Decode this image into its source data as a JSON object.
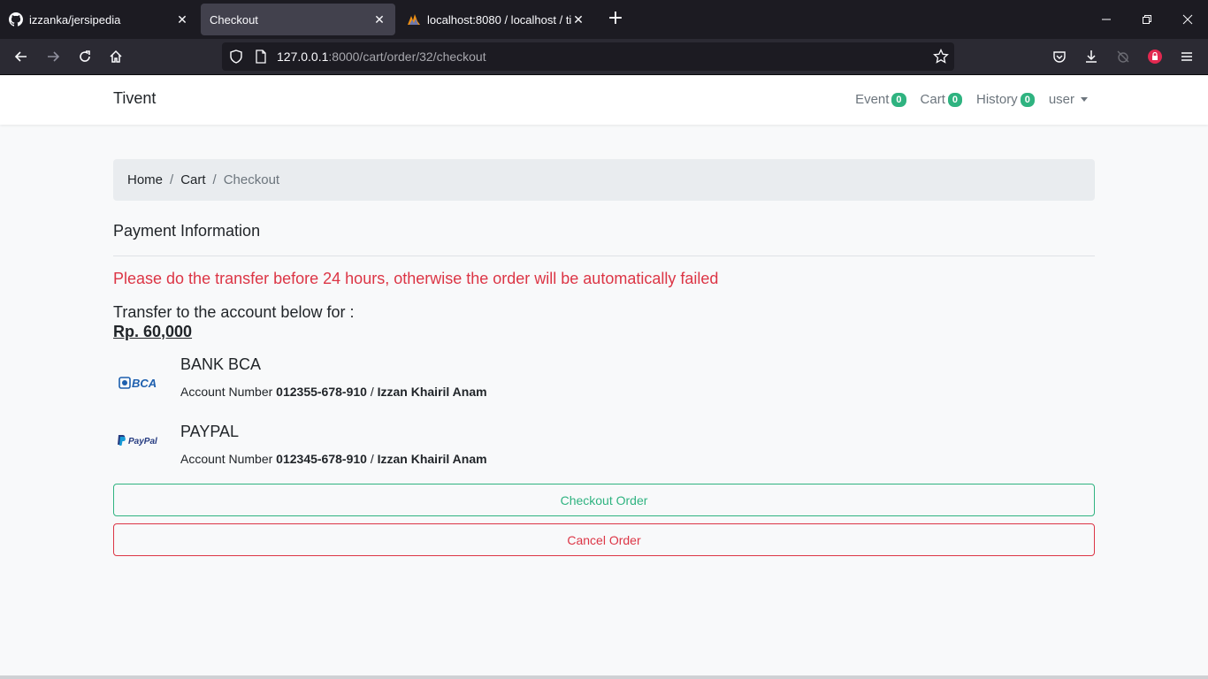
{
  "browser": {
    "tabs": [
      {
        "title": "izzanka/jersipedia",
        "icon": "github-icon"
      },
      {
        "title": "Checkout",
        "icon": ""
      },
      {
        "title": "localhost:8080 / localhost / tiver",
        "icon": "phpmyadmin-icon"
      }
    ],
    "url_host": "127.0.0.1",
    "url_path": ":8000/cart/order/32/checkout"
  },
  "app": {
    "brand": "Tivent",
    "nav": {
      "event_label": "Event",
      "event_count": "0",
      "cart_label": "Cart",
      "cart_count": "0",
      "history_label": "History",
      "history_count": "0",
      "user_label": "user"
    },
    "breadcrumb": {
      "home": "Home",
      "cart": "Cart",
      "current": "Checkout"
    },
    "payment": {
      "title": "Payment Information",
      "warning": "Please do the transfer before 24 hours, otherwise the order will be automatically failed",
      "transfer_label": "Transfer to the account below for :",
      "amount": "Rp. 60,000"
    },
    "banks": [
      {
        "name": "BANK BCA",
        "logo_text": "BCA",
        "account_label": "Account Number",
        "account_number": "012355-678-910",
        "separator": "/",
        "account_holder": "Izzan Khairil Anam"
      },
      {
        "name": "PAYPAL",
        "logo_text": "PayPal",
        "account_label": "Account Number",
        "account_number": "012345-678-910",
        "separator": "/",
        "account_holder": "Izzan Khairil Anam"
      }
    ],
    "buttons": {
      "checkout": "Checkout Order",
      "cancel": "Cancel Order"
    }
  },
  "colors": {
    "success": "#2fb380",
    "danger": "#dc3545",
    "bca_blue": "#1d5fae",
    "paypal_dark": "#253b80",
    "paypal_light": "#179bd7"
  }
}
